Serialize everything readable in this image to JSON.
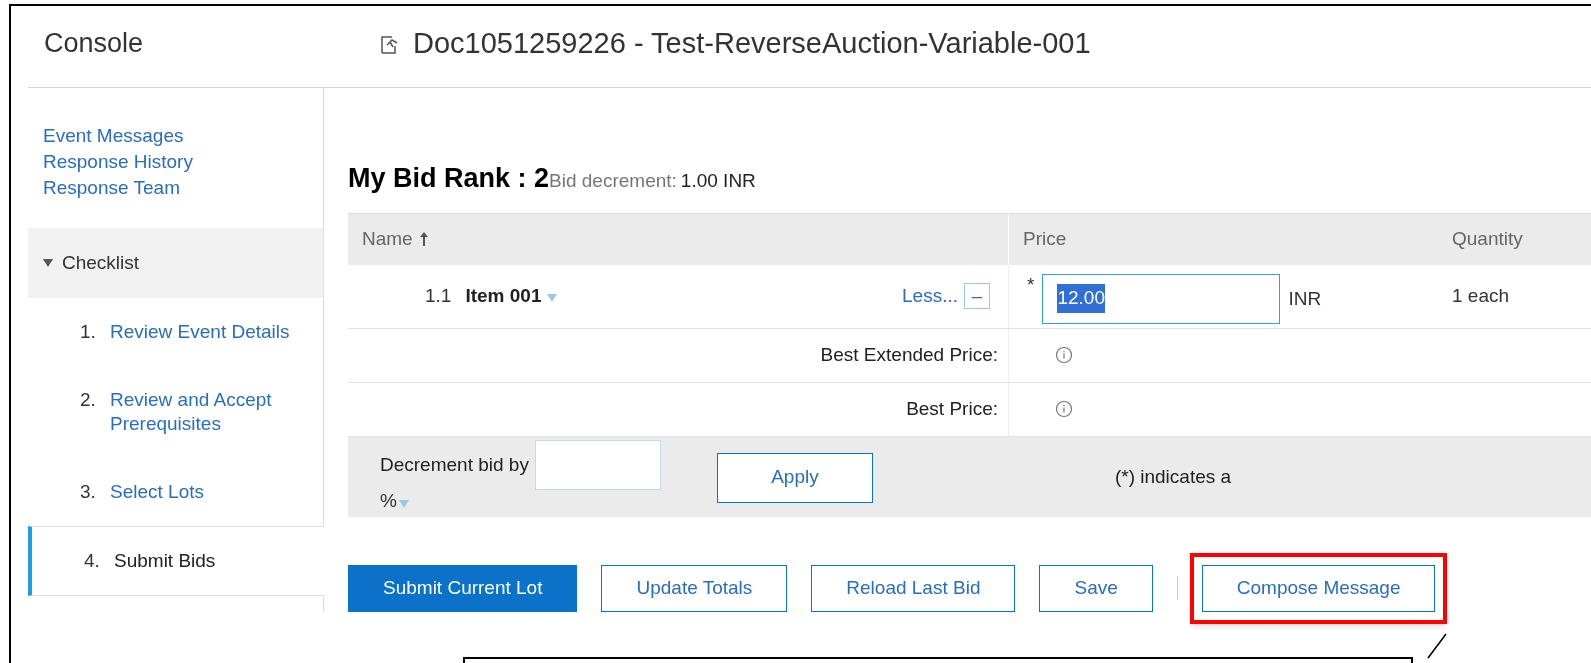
{
  "header": {
    "console_title": "Console",
    "doc_title": "Doc1051259226 - Test-ReverseAuction-Variable-001"
  },
  "sidebar": {
    "links": [
      "Event Messages",
      "Response History",
      "Response Team"
    ],
    "checklist": {
      "title": "Checklist",
      "expanded": true,
      "steps": [
        {
          "number": "1.",
          "label": "Review Event Details",
          "selected": false
        },
        {
          "number": "2.",
          "label": "Review and Accept Prerequisites",
          "selected": false
        },
        {
          "number": "3.",
          "label": "Select Lots",
          "selected": false
        },
        {
          "number": "4.",
          "label": "Submit Bids",
          "selected": true
        }
      ]
    }
  },
  "bid_rank": {
    "title": "My Bid Rank : 2",
    "decrement_label": "Bid decrement:",
    "decrement_value": "1.00 INR"
  },
  "table": {
    "columns": [
      {
        "label": "Name",
        "sorted": true
      },
      {
        "label": "Price",
        "sorted": false
      },
      {
        "label": "Quantity",
        "sorted": false
      }
    ],
    "item": {
      "number": "1.1",
      "name": "Item 001",
      "less_link": "Less...",
      "collapse": "–",
      "required": "*",
      "price": "12.00",
      "currency": "INR",
      "quantity": "1 each"
    },
    "detail_rows": [
      "Best Extended Price:",
      "Best Price:"
    ]
  },
  "decrement": {
    "label": "Decrement bid by",
    "unit": "%",
    "apply": "Apply",
    "note": "(*) indicates a"
  },
  "buttons": [
    {
      "label": "Submit Current Lot",
      "kind": "primary",
      "highlighted": false
    },
    {
      "label": "Update Totals",
      "kind": "secondary",
      "highlighted": false
    },
    {
      "label": "Reload Last Bid",
      "kind": "secondary",
      "highlighted": false
    },
    {
      "label": "Save",
      "kind": "secondary",
      "highlighted": false
    },
    {
      "label": "Compose Message",
      "kind": "secondary",
      "highlighted": true
    }
  ]
}
